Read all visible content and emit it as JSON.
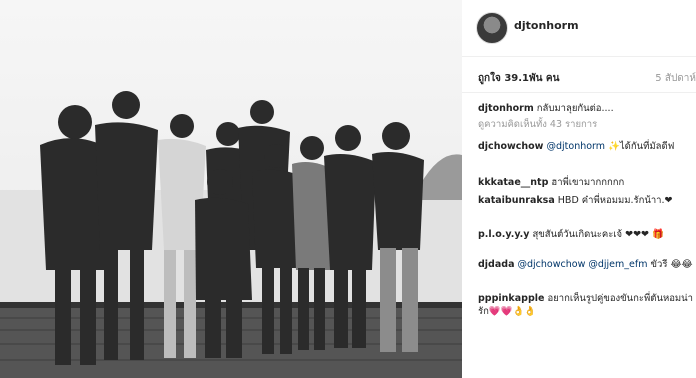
{
  "post": {
    "username": "djtonhorm",
    "likes": "ถูกใจ 39.1พัน คน",
    "time": "5 สัปดาห์"
  },
  "comments": [
    {
      "user": "djtonhorm",
      "text": "กลับมาลุยกันต่อ....",
      "mention": ""
    },
    {
      "user": "",
      "text": "ดูความคิดเห็นทั้ง 43 รายการ",
      "mention": ""
    },
    {
      "user": "djchowchow",
      "mention": "@djtonhorm",
      "text": "✨ได้กันที่มัลดีฟ"
    },
    {
      "user": "kkkatae__ntp",
      "text": "ฮาพี่เขามากกกกก",
      "mention": ""
    },
    {
      "user": "kataibunraksa",
      "text": "HBD ค๋าพี่หอมมม.รักน้าา.❤",
      "mention": ""
    },
    {
      "user": "p.l.o.y.y.y",
      "text": "สุขสันต์วันเกิดนะคะเจ้ ❤❤❤ 🎁",
      "mention": ""
    },
    {
      "user": "djdada",
      "mention": "@djchowchow @djjem_efm",
      "text": "ขัวรี 😂😂"
    },
    {
      "user": "pppinkapple",
      "text": "อยากเห็นรูปคู่ของขันกะพี่ตันหอมน่ารัก💗💗👌👌",
      "mention": ""
    }
  ]
}
